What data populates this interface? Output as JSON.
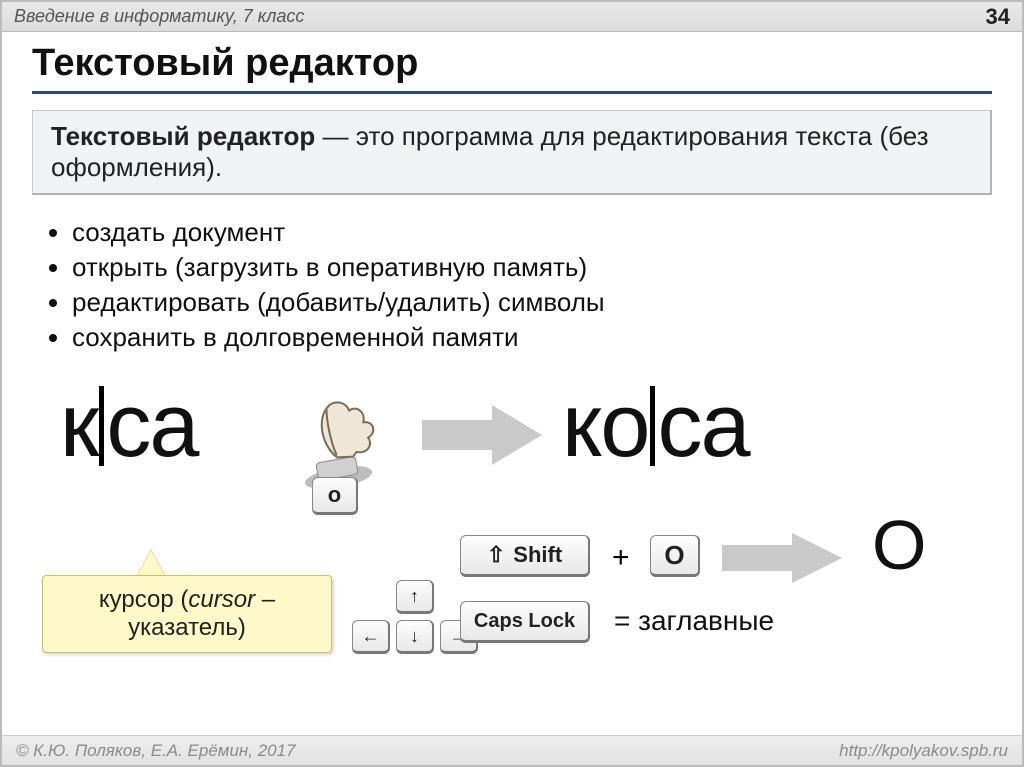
{
  "header": {
    "subject": "Введение в информатику, 7 класс",
    "page": "34"
  },
  "title": "Текстовый редактор",
  "definition": {
    "term": "Текстовый редактор",
    "dash": " — ",
    "body": "это программа для редактирования текста (без оформления)."
  },
  "bullets": [
    "создать документ",
    "открыть (загрузить в оперативную память)",
    "редактировать (добавить/удалить) символы",
    "сохранить в долговременной памяти"
  ],
  "diagram": {
    "word1_left": "к",
    "word1_right": "са",
    "word2_left": "ко",
    "word2_right": "са",
    "typed_key": "о",
    "callout_line1": "курсор (",
    "callout_italic": "cursor",
    "callout_line2": " – указатель)",
    "shift_label": "Shift",
    "caps_label": "Caps Lock",
    "plus": "+",
    "upper_o_key": "О",
    "upper_o_result": "О",
    "caps_equals": "= заглавные",
    "arrow_up": "↑",
    "arrow_left": "←",
    "arrow_down": "↓",
    "arrow_right": "→",
    "shift_arrow": "⇧"
  },
  "footer": {
    "left": "© К.Ю. Поляков, Е.А. Ерёмин, 2017",
    "right": "http://kpolyakov.spb.ru"
  }
}
